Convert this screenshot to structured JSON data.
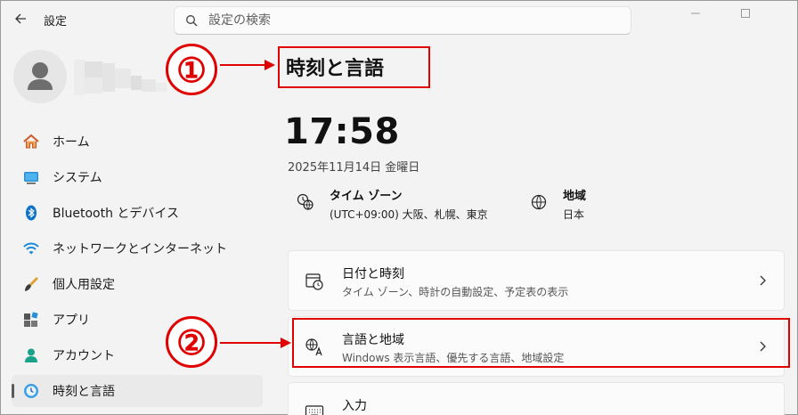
{
  "window": {
    "title": "設定"
  },
  "search": {
    "placeholder": "設定の検索"
  },
  "sidebar": {
    "items": [
      {
        "label": "ホーム"
      },
      {
        "label": "システム"
      },
      {
        "label": "Bluetooth とデバイス"
      },
      {
        "label": "ネットワークとインターネット"
      },
      {
        "label": "個人用設定"
      },
      {
        "label": "アプリ"
      },
      {
        "label": "アカウント"
      },
      {
        "label": "時刻と言語"
      }
    ],
    "active_index": 7
  },
  "main": {
    "title": "時刻と言語",
    "time": "17:58",
    "date": "2025年11月14日 金曜日",
    "timezone": {
      "title": "タイム ゾーン",
      "value": "(UTC+09:00) 大阪、札幌、東京"
    },
    "region": {
      "title": "地域",
      "value": "日本"
    },
    "cards": [
      {
        "title": "日付と時刻",
        "subtitle": "タイム ゾーン、時計の自動設定、予定表の表示"
      },
      {
        "title": "言語と地域",
        "subtitle": "Windows 表示言語、優先する言語、地域設定"
      },
      {
        "title": "入力",
        "subtitle": ""
      }
    ]
  },
  "annotations": {
    "marker1": "①",
    "marker2": "②"
  },
  "colors": {
    "accent": "#0067c0",
    "highlight": "#e00000"
  }
}
